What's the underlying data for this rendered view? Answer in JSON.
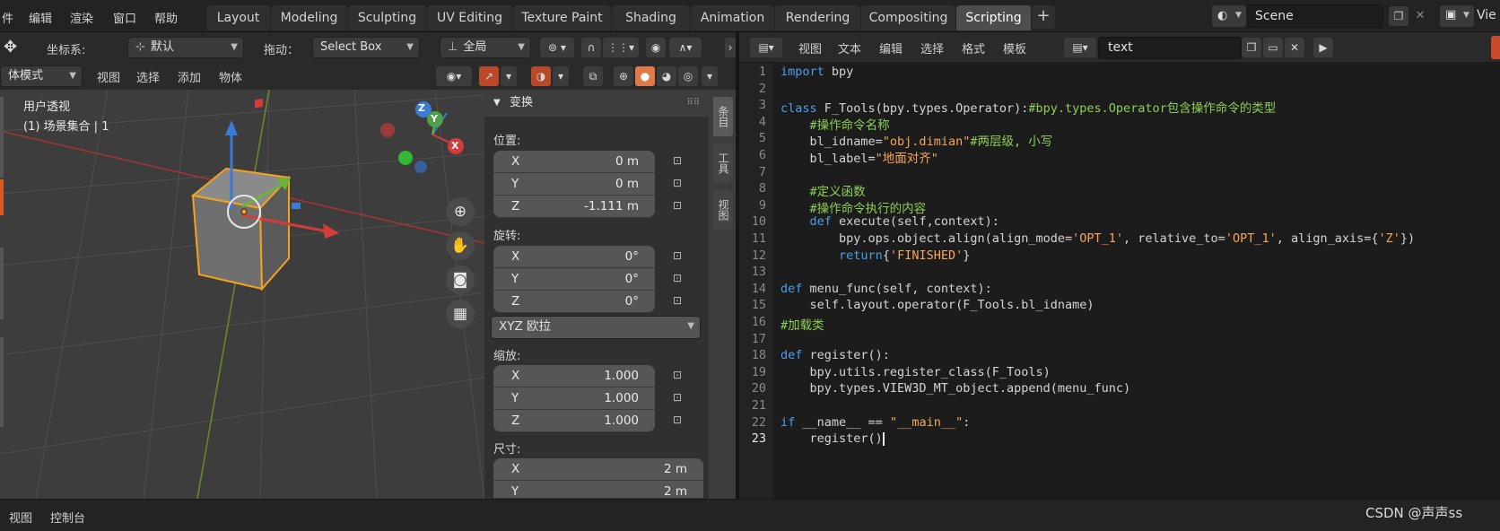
{
  "menubar": {
    "items": [
      "件",
      "编辑",
      "渲染",
      "窗口",
      "帮助"
    ]
  },
  "workspaces": [
    "Layout",
    "Modeling",
    "Sculpting",
    "UV Editing",
    "Texture Paint",
    "Shading",
    "Animation",
    "Rendering",
    "Compositing",
    "Scripting"
  ],
  "active_workspace": "Scripting",
  "scene": {
    "name": "Scene",
    "view_layer": "Vie"
  },
  "viewport_toolbar": {
    "orientation_label": "坐标系:",
    "orientation_value": "默认",
    "drag_label": "拖动：",
    "drag_value": "Select Box",
    "transform_value": "全局"
  },
  "viewport_header": {
    "mode": "体模式",
    "menus": [
      "视图",
      "选择",
      "添加",
      "物体"
    ]
  },
  "viewport_overlay": {
    "view_name": "用户透视",
    "collection": "(1) 场景集合 | 1"
  },
  "gizmo": {
    "x": "X",
    "y": "Y",
    "z": "Z"
  },
  "transform_panel": {
    "title": "变换",
    "location_label": "位置:",
    "location": [
      {
        "axis": "X",
        "value": "0 m"
      },
      {
        "axis": "Y",
        "value": "0 m"
      },
      {
        "axis": "Z",
        "value": "-1.111 m"
      }
    ],
    "rotation_label": "旋转:",
    "rotation": [
      {
        "axis": "X",
        "value": "0°"
      },
      {
        "axis": "Y",
        "value": "0°"
      },
      {
        "axis": "Z",
        "value": "0°"
      }
    ],
    "rotation_mode": "XYZ 欧拉",
    "scale_label": "缩放:",
    "scale": [
      {
        "axis": "X",
        "value": "1.000"
      },
      {
        "axis": "Y",
        "value": "1.000"
      },
      {
        "axis": "Z",
        "value": "1.000"
      }
    ],
    "dimensions_label": "尺寸:",
    "dimensions": [
      {
        "axis": "X",
        "value": "2 m"
      },
      {
        "axis": "Y",
        "value": "2 m"
      }
    ]
  },
  "side_tabs": [
    "条目",
    "工具",
    "视图"
  ],
  "text_editor": {
    "menus": [
      "视图",
      "文本",
      "编辑",
      "选择",
      "格式",
      "模板"
    ],
    "text_name": "text",
    "current_line": 23
  },
  "code_lines": [
    "import bpy",
    "",
    "class F_Tools(bpy.types.Operator):#bpy.types.Operator包含操作命令的类型",
    "    #操作命令名称",
    "    bl_idname=\"obj.dimian\"#两层级, 小写",
    "    bl_label=\"地面对齐\"",
    "",
    "    #定义函数",
    "    #操作命令执行的内容",
    "    def execute(self,context):",
    "        bpy.ops.object.align(align_mode='OPT_1', relative_to='OPT_1', align_axis={'Z'})",
    "        return{'FINISHED'}",
    "",
    "def menu_func(self, context):",
    "    self.layout.operator(F_Tools.bl_idname)",
    "#加载类",
    "",
    "def register():",
    "    bpy.utils.register_class(F_Tools)",
    "    bpy.types.VIEW3D_MT_object.append(menu_func)",
    "",
    "if __name__ == \"__main__\":",
    "    register()"
  ],
  "statusbar": {
    "items": [
      "视图",
      "控制台"
    ]
  },
  "watermark": "CSDN @声声ss",
  "colors": {
    "accent": "#4772b3",
    "keyword": "#4d9ded",
    "comment": "#8ccf54",
    "string": "#f5a65b",
    "selected_orange": "#f6a31a"
  }
}
